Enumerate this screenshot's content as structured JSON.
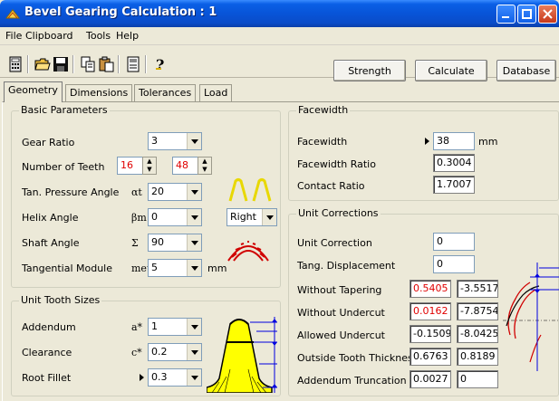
{
  "window": {
    "title": "Bevel Gearing Calculation : 1"
  },
  "menu": [
    "File",
    "Clipboard",
    "Tools",
    "Help"
  ],
  "toolbar": {
    "strength": "Strength",
    "calculate": "Calculate",
    "database": "Database"
  },
  "tabs": [
    "Geometry",
    "Dimensions",
    "Tolerances",
    "Load"
  ],
  "basic": {
    "title": "Basic Parameters",
    "gear_ratio": {
      "label": "Gear Ratio",
      "value": "3"
    },
    "teeth": {
      "label": "Number of Teeth",
      "z1": "16",
      "z2": "48"
    },
    "pressure": {
      "label": "Tan. Pressure Angle",
      "symbol": "αt",
      "value": "20"
    },
    "helix": {
      "label": "Helix Angle",
      "symbol": "βm",
      "value": "0",
      "hand": "Right"
    },
    "shaft": {
      "label": "Shaft Angle",
      "symbol": "Σ",
      "value": "90"
    },
    "module": {
      "label": "Tangential Module",
      "symbol": "met",
      "value": "5",
      "unit": "mm"
    }
  },
  "unit_tooth": {
    "title": "Unit Tooth Sizes",
    "addendum": {
      "label": "Addendum",
      "symbol": "a*",
      "value": "1"
    },
    "clearance": {
      "label": "Clearance",
      "symbol": "c*",
      "value": "0.2"
    },
    "root_fillet": {
      "label": "Root Fillet",
      "value": "0.3"
    }
  },
  "facewidth": {
    "title": "Facewidth",
    "facewidth": {
      "label": "Facewidth",
      "value": "38",
      "unit": "mm"
    },
    "ratio": {
      "label": "Facewidth Ratio",
      "value": "0.3004"
    },
    "contact": {
      "label": "Contact Ratio",
      "value": "1.7007"
    }
  },
  "corrections": {
    "title": "Unit Corrections",
    "unit_corr": {
      "label": "Unit Correction",
      "value": "0"
    },
    "tang_disp": {
      "label": "Tang. Displacement",
      "value": "0"
    },
    "without_tapering": {
      "label": "Without Tapering",
      "v1": "0.5405",
      "v2": "-3.5517"
    },
    "without_undercut": {
      "label": "Without Undercut",
      "v1": "0.0162",
      "v2": "-7.8754"
    },
    "allowed_undercut": {
      "label": "Allowed Undercut",
      "v1": "-0.1509",
      "v2": "-8.0425"
    },
    "outside_thickness": {
      "label": "Outside Tooth Thickness",
      "v1": "0.6763",
      "v2": "0.8189"
    },
    "addendum_trunc": {
      "label": "Addendum Truncation",
      "v1": "0.0027",
      "v2": "0"
    }
  },
  "colors": {
    "title_blue": "#0854D8",
    "red_value": "#E00000",
    "diagram_yellow": "#FFFF00"
  }
}
